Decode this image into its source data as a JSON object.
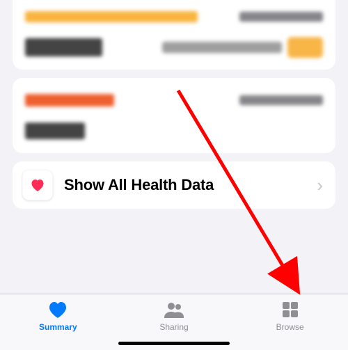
{
  "show_all": {
    "label": "Show All Health Data"
  },
  "tabs": {
    "summary": "Summary",
    "sharing": "Sharing",
    "browse": "Browse"
  }
}
